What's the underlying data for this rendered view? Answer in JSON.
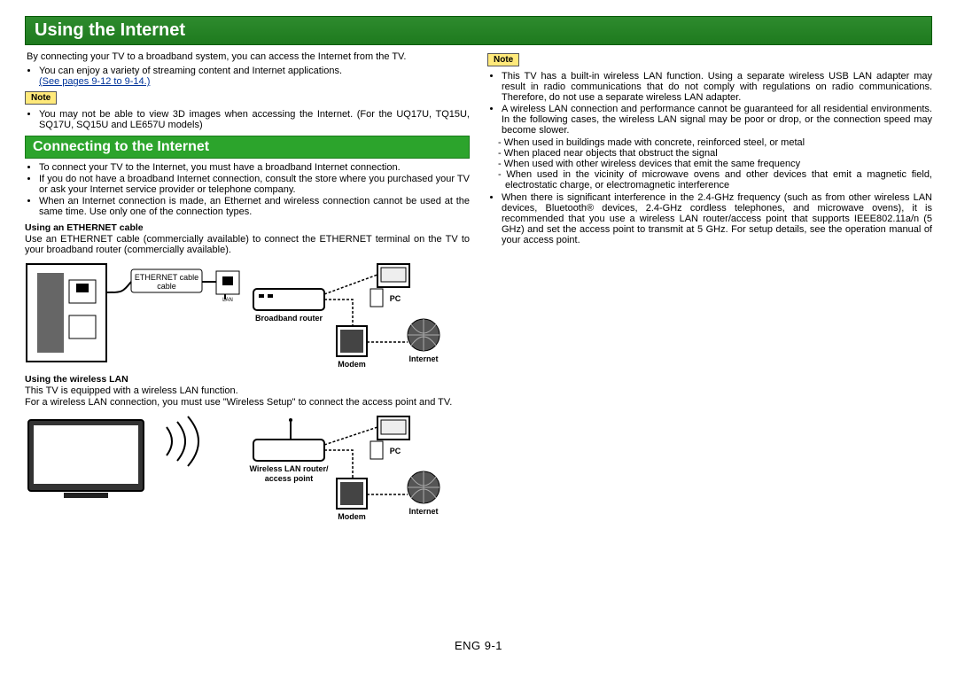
{
  "header": {
    "title": "Using the Internet"
  },
  "intro": {
    "line1": "By connecting your TV to a broadband system, you can access the Internet from the TV.",
    "bullets": [
      "You can enjoy a variety of streaming content and Internet applications."
    ],
    "link": "(See pages 9-12 to 9-14.)"
  },
  "note1": {
    "label": "Note",
    "bullets": [
      "You may not be able to view 3D images when accessing the Internet. (For the UQ17U, TQ15U, SQ17U, SQ15U and LE657U models)"
    ]
  },
  "connecting": {
    "heading": "Connecting to the Internet",
    "bullets": [
      "To connect your TV to the Internet, you must have a broadband Internet connection.",
      "If you do not have a broadband Internet connection, consult the store where you purchased your TV or ask your Internet service provider or telephone company.",
      "When an Internet connection is made, an Ethernet and wireless connection cannot be used at the same time. Use only one of the connection types."
    ],
    "ethernet_sub": "Using an ETHERNET cable",
    "ethernet_body": "Use an ETHERNET cable (commercially available) to connect the ETHERNET terminal on the TV to your broadband router (commercially available).",
    "wlan_sub": "Using the wireless LAN",
    "wlan_body1": "This TV is equipped with a wireless LAN function.",
    "wlan_body2": "For a wireless LAN connection, you must use \"Wireless Setup\" to connect the access point and TV."
  },
  "note2": {
    "label": "Note",
    "bullets": [
      "This TV has a built-in wireless LAN function. Using a separate wireless USB LAN adapter may result in radio communications that do not comply with regulations on radio communications. Therefore, do not use a separate wireless LAN adapter.",
      "A wireless LAN connection and performance cannot be guaranteed for all residential environments. In the following cases, the wireless LAN signal may be poor or drop, or the connection speed may become slower."
    ],
    "dash": [
      "- When used in buildings made with concrete, reinforced steel, or metal",
      "- When placed near objects that obstruct the signal",
      "- When used with other wireless devices that emit the same frequency",
      "- When used in the vicinity of microwave ovens and other devices that emit a magnetic field, electrostatic charge, or electromagnetic interference"
    ],
    "bullets2": [
      "When there is significant interference in the 2.4-GHz frequency (such as from other wireless LAN devices, Bluetooth® devices, 2.4-GHz cordless telephones, and microwave ovens), it is recommended that you use a wireless LAN router/access point that supports IEEE802.11a/n (5 GHz) and set the access point to transmit at 5 GHz. For setup details, see the operation manual of your access point."
    ]
  },
  "diagram1": {
    "ethernet_cable": "ETHERNET cable",
    "lan": "LAN",
    "router": "Broadband router",
    "modem": "Modem",
    "pc": "PC",
    "internet": "Internet"
  },
  "diagram2": {
    "wlan_router": "Wireless LAN router/",
    "access_point": "access point",
    "modem": "Modem",
    "pc": "PC",
    "internet": "Internet"
  },
  "page_number": "ENG 9-1"
}
